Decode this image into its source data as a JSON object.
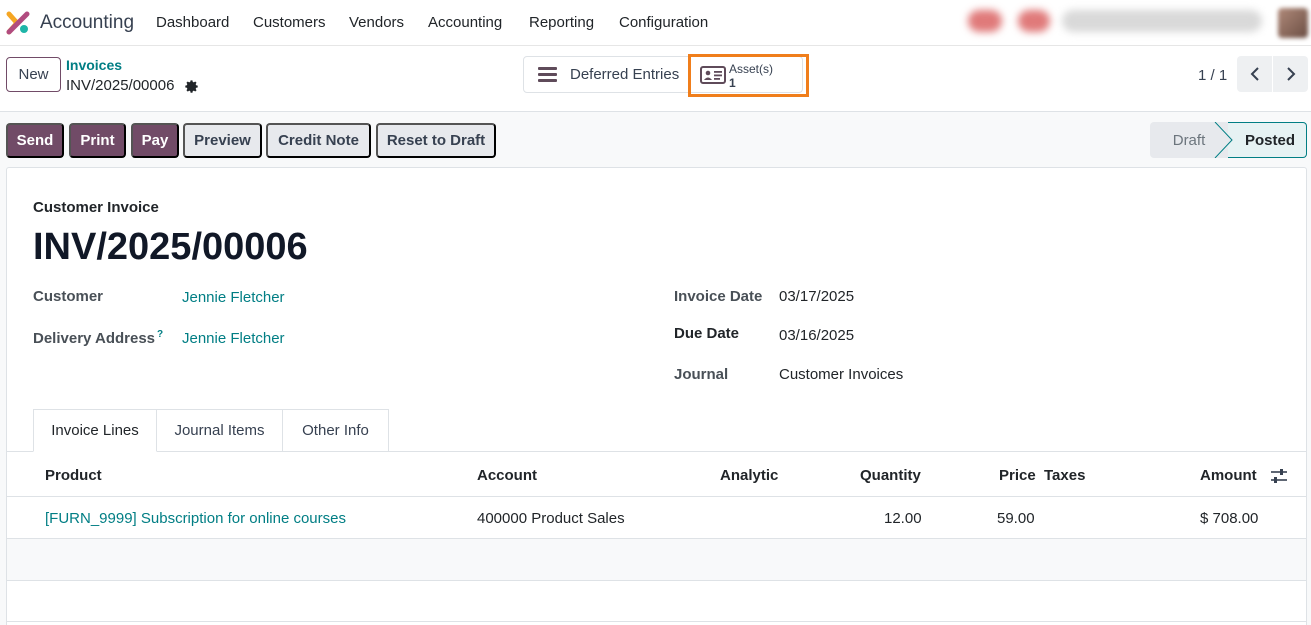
{
  "navbar": {
    "app_name": "Accounting",
    "menu": [
      "Dashboard",
      "Customers",
      "Vendors",
      "Accounting",
      "Reporting",
      "Configuration"
    ]
  },
  "control": {
    "new_label": "New",
    "breadcrumb_parent": "Invoices",
    "breadcrumb_current": "INV/2025/00006",
    "smart_deferred": "Deferred Entries",
    "smart_asset_label": "Asset(s)",
    "smart_asset_count": "1",
    "pager": "1 / 1"
  },
  "actions": {
    "send": "Send",
    "print": "Print",
    "pay": "Pay",
    "preview": "Preview",
    "credit_note": "Credit Note",
    "reset_to_draft": "Reset to Draft"
  },
  "status": {
    "draft": "Draft",
    "posted": "Posted",
    "current": "Posted"
  },
  "invoice": {
    "type": "Customer Invoice",
    "name": "INV/2025/00006",
    "customer_label": "Customer",
    "customer": "Jennie Fletcher",
    "delivery_label": "Delivery Address",
    "delivery_help": "?",
    "delivery": "Jennie Fletcher",
    "invoice_date_label": "Invoice Date",
    "invoice_date": "03/17/2025",
    "due_date_label": "Due Date",
    "due_date": "03/16/2025",
    "journal_label": "Journal",
    "journal": "Customer Invoices"
  },
  "tabs": [
    "Invoice Lines",
    "Journal Items",
    "Other Info"
  ],
  "table": {
    "headers": [
      "Product",
      "Account",
      "Analytic",
      "Quantity",
      "Price",
      "Taxes",
      "Amount"
    ],
    "rows": [
      {
        "product": "[FURN_9999] Subscription for online courses",
        "account": "400000 Product Sales",
        "analytic": "",
        "quantity": "12.00",
        "price": "59.00",
        "taxes": "",
        "amount": "$ 708.00"
      }
    ]
  },
  "colors": {
    "primary": "#714b67",
    "link": "#017e84",
    "highlight": "#f07e1b"
  }
}
